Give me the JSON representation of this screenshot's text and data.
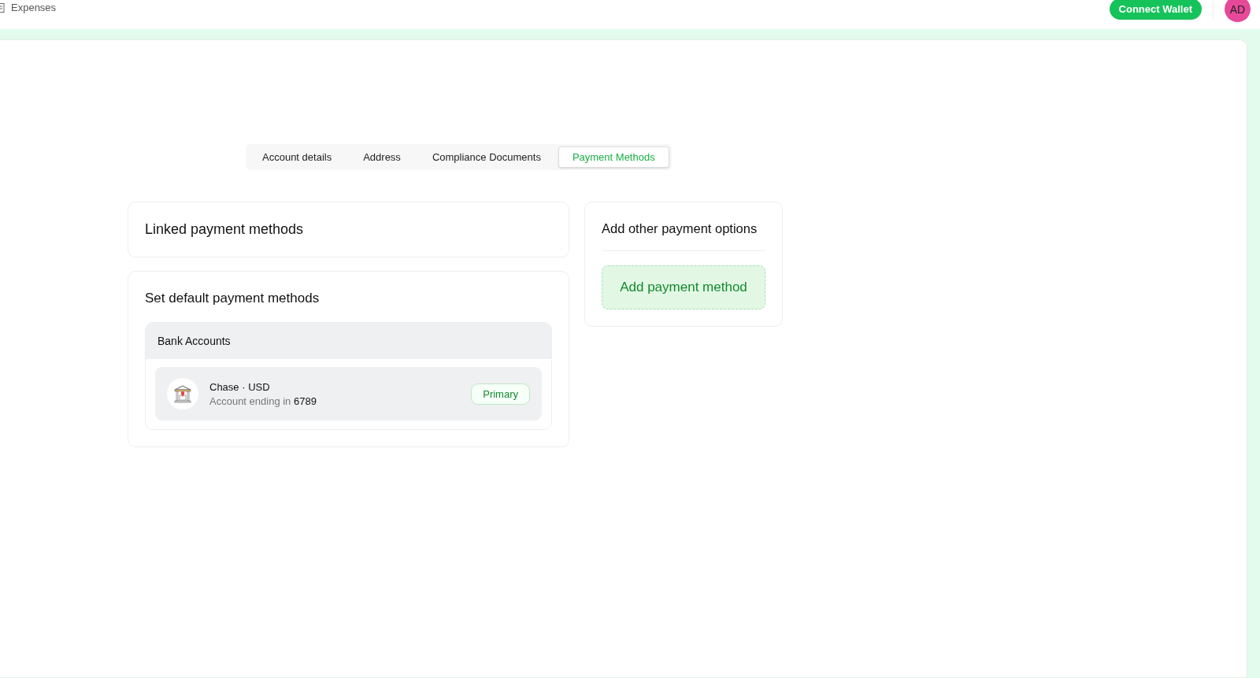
{
  "header": {
    "breadcrumb": "Expenses",
    "connect_button": "Connect Wallet",
    "avatar": "AD"
  },
  "tabs": [
    {
      "label": "Account details",
      "selected": false
    },
    {
      "label": "Address",
      "selected": false
    },
    {
      "label": "Compliance Documents",
      "selected": false
    },
    {
      "label": "Payment Methods",
      "selected": true
    }
  ],
  "linked": {
    "title": "Linked payment methods"
  },
  "defaults": {
    "title": "Set default payment methods",
    "group": "Bank Accounts",
    "accounts": [
      {
        "bank": "Chase",
        "separator": "·",
        "currency": "USD",
        "ending_label": "Account ending in",
        "ending": "6789",
        "badge": "Primary"
      }
    ]
  },
  "add_panel": {
    "title": "Add other payment options",
    "button": "Add payment method"
  }
}
